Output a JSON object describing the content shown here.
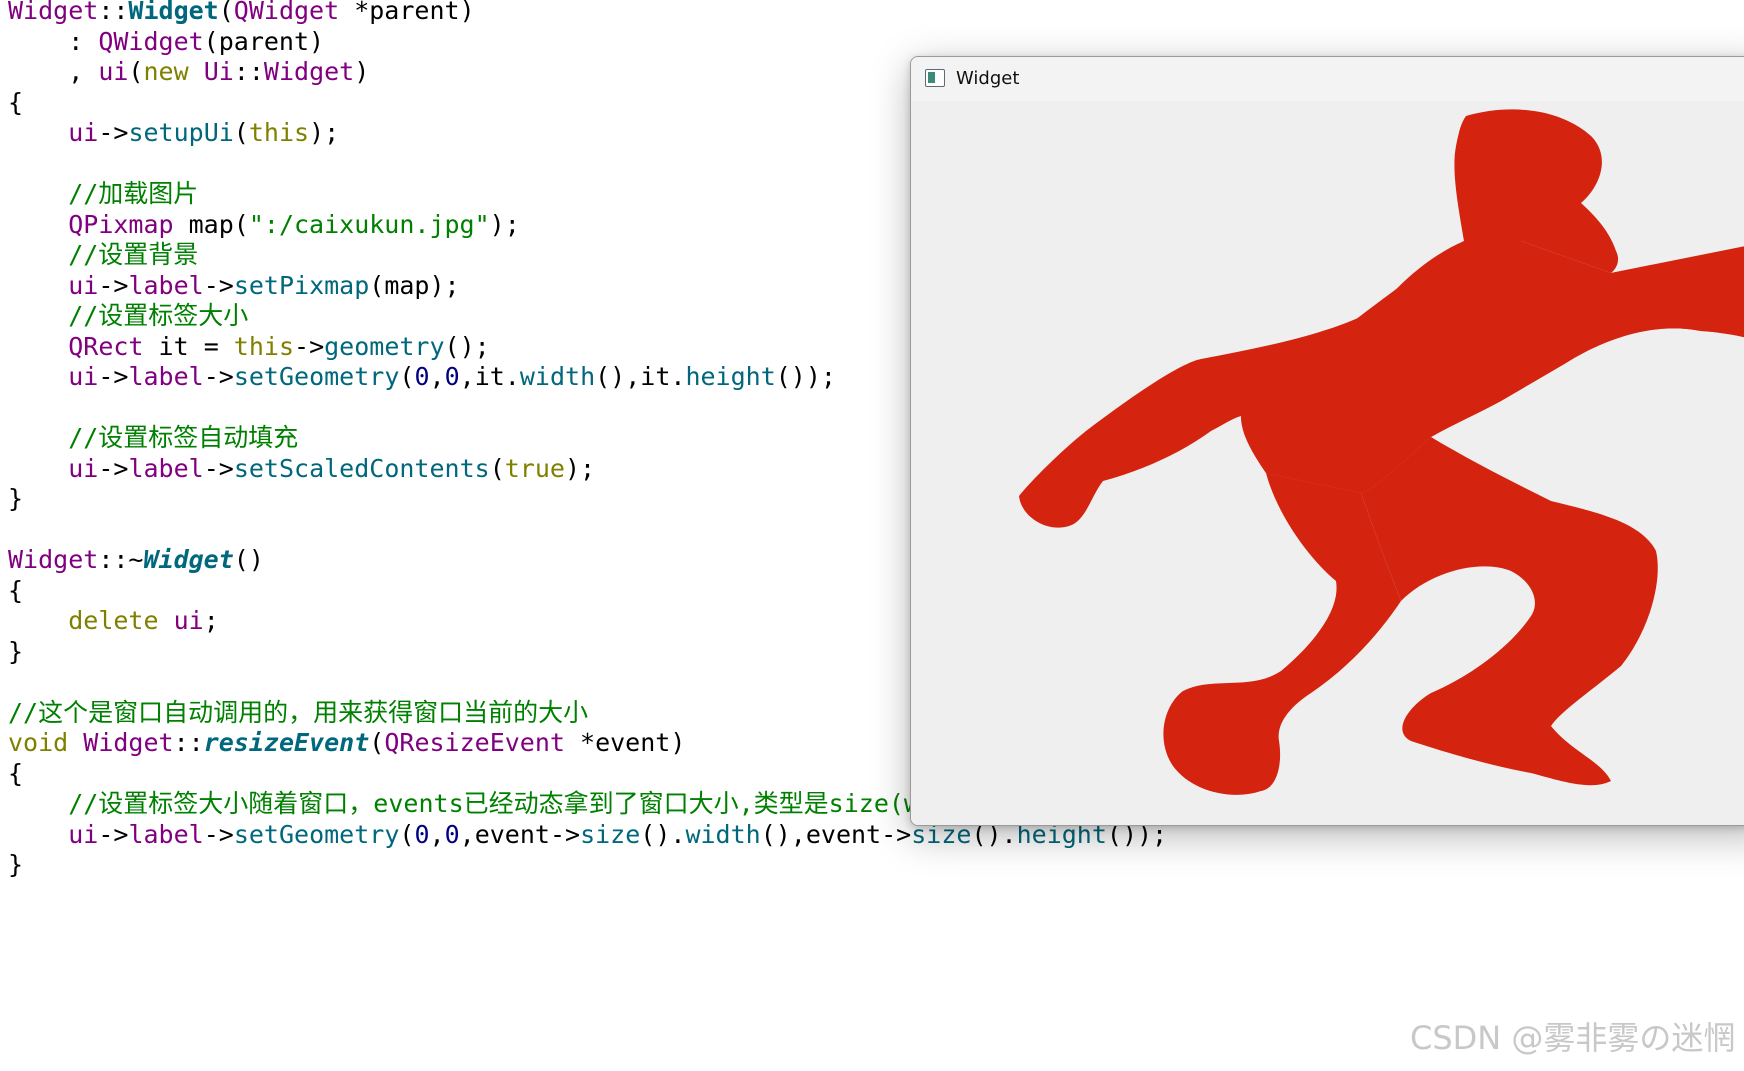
{
  "code_editor": {
    "lines": [
      [
        {
          "t": "Widget",
          "c": "type"
        },
        {
          "t": "::",
          "c": "plain"
        },
        {
          "t": "Widget",
          "c": "fn-bold"
        },
        {
          "t": "(",
          "c": "plain"
        },
        {
          "t": "QWidget",
          "c": "type"
        },
        {
          "t": " *parent)",
          "c": "plain"
        }
      ],
      [
        {
          "t": "    : ",
          "c": "plain"
        },
        {
          "t": "QWidget",
          "c": "type"
        },
        {
          "t": "(parent)",
          "c": "plain"
        }
      ],
      [
        {
          "t": "    , ",
          "c": "plain"
        },
        {
          "t": "ui",
          "c": "type"
        },
        {
          "t": "(",
          "c": "plain"
        },
        {
          "t": "new",
          "c": "kw"
        },
        {
          "t": " ",
          "c": "plain"
        },
        {
          "t": "Ui",
          "c": "type"
        },
        {
          "t": "::",
          "c": "plain"
        },
        {
          "t": "Widget",
          "c": "type"
        },
        {
          "t": ")",
          "c": "plain"
        }
      ],
      [
        {
          "t": "{",
          "c": "plain"
        }
      ],
      [
        {
          "t": "    ",
          "c": "plain"
        },
        {
          "t": "ui",
          "c": "type"
        },
        {
          "t": "->",
          "c": "plain"
        },
        {
          "t": "setupUi",
          "c": "fn"
        },
        {
          "t": "(",
          "c": "plain"
        },
        {
          "t": "this",
          "c": "kw"
        },
        {
          "t": ");",
          "c": "plain"
        }
      ],
      [],
      [
        {
          "t": "    //加载图片",
          "c": "cmt"
        }
      ],
      [
        {
          "t": "    ",
          "c": "plain"
        },
        {
          "t": "QPixmap",
          "c": "type"
        },
        {
          "t": " map(",
          "c": "plain"
        },
        {
          "t": "\":/caixukun.jpg\"",
          "c": "str"
        },
        {
          "t": ");",
          "c": "plain"
        }
      ],
      [
        {
          "t": "    //设置背景",
          "c": "cmt"
        }
      ],
      [
        {
          "t": "    ",
          "c": "plain"
        },
        {
          "t": "ui",
          "c": "type"
        },
        {
          "t": "->",
          "c": "plain"
        },
        {
          "t": "label",
          "c": "type"
        },
        {
          "t": "->",
          "c": "plain"
        },
        {
          "t": "setPixmap",
          "c": "fn"
        },
        {
          "t": "(map);",
          "c": "plain"
        }
      ],
      [
        {
          "t": "    //设置标签大小",
          "c": "cmt"
        }
      ],
      [
        {
          "t": "    ",
          "c": "plain"
        },
        {
          "t": "QRect",
          "c": "type"
        },
        {
          "t": " it = ",
          "c": "plain"
        },
        {
          "t": "this",
          "c": "kw"
        },
        {
          "t": "->",
          "c": "plain"
        },
        {
          "t": "geometry",
          "c": "fn"
        },
        {
          "t": "();",
          "c": "plain"
        }
      ],
      [
        {
          "t": "    ",
          "c": "plain"
        },
        {
          "t": "ui",
          "c": "type"
        },
        {
          "t": "->",
          "c": "plain"
        },
        {
          "t": "label",
          "c": "type"
        },
        {
          "t": "->",
          "c": "plain"
        },
        {
          "t": "setGeometry",
          "c": "fn"
        },
        {
          "t": "(",
          "c": "plain"
        },
        {
          "t": "0",
          "c": "num"
        },
        {
          "t": ",",
          "c": "plain"
        },
        {
          "t": "0",
          "c": "num"
        },
        {
          "t": ",it.",
          "c": "plain"
        },
        {
          "t": "width",
          "c": "fn"
        },
        {
          "t": "(),it.",
          "c": "plain"
        },
        {
          "t": "height",
          "c": "fn"
        },
        {
          "t": "());",
          "c": "plain"
        }
      ],
      [],
      [
        {
          "t": "    //设置标签自动填充",
          "c": "cmt"
        }
      ],
      [
        {
          "t": "    ",
          "c": "plain"
        },
        {
          "t": "ui",
          "c": "type"
        },
        {
          "t": "->",
          "c": "plain"
        },
        {
          "t": "label",
          "c": "type"
        },
        {
          "t": "->",
          "c": "plain"
        },
        {
          "t": "setScaledContents",
          "c": "fn"
        },
        {
          "t": "(",
          "c": "plain"
        },
        {
          "t": "true",
          "c": "kw"
        },
        {
          "t": ");",
          "c": "plain"
        }
      ],
      [
        {
          "t": "}",
          "c": "plain"
        }
      ],
      [],
      [
        {
          "t": "Widget",
          "c": "type"
        },
        {
          "t": "::~",
          "c": "plain"
        },
        {
          "t": "Widget",
          "c": "fn-bold-italic"
        },
        {
          "t": "()",
          "c": "plain"
        }
      ],
      [
        {
          "t": "{",
          "c": "plain"
        }
      ],
      [
        {
          "t": "    ",
          "c": "plain"
        },
        {
          "t": "delete",
          "c": "kw"
        },
        {
          "t": " ",
          "c": "plain"
        },
        {
          "t": "ui",
          "c": "type"
        },
        {
          "t": ";",
          "c": "plain"
        }
      ],
      [
        {
          "t": "}",
          "c": "plain"
        }
      ],
      [],
      [
        {
          "t": "//这个是窗口自动调用的，用来获得窗口当前的大小",
          "c": "cmt"
        }
      ],
      [
        {
          "t": "void",
          "c": "kw"
        },
        {
          "t": " ",
          "c": "plain"
        },
        {
          "t": "Widget",
          "c": "type"
        },
        {
          "t": "::",
          "c": "plain"
        },
        {
          "t": "resizeEvent",
          "c": "fn-bold-italic"
        },
        {
          "t": "(",
          "c": "plain"
        },
        {
          "t": "QResizeEvent",
          "c": "type"
        },
        {
          "t": " *event)",
          "c": "plain"
        }
      ],
      [
        {
          "t": "{",
          "c": "plain"
        }
      ],
      [
        {
          "t": "    //设置标签大小随着窗口，events已经动态拿到了窗口大小,类型是size(width,height)",
          "c": "cmt"
        }
      ],
      [
        {
          "t": "    ",
          "c": "plain"
        },
        {
          "t": "ui",
          "c": "type"
        },
        {
          "t": "->",
          "c": "plain"
        },
        {
          "t": "label",
          "c": "type"
        },
        {
          "t": "->",
          "c": "plain"
        },
        {
          "t": "setGeometry",
          "c": "fn"
        },
        {
          "t": "(",
          "c": "plain"
        },
        {
          "t": "0",
          "c": "num"
        },
        {
          "t": ",",
          "c": "plain"
        },
        {
          "t": "0",
          "c": "num"
        },
        {
          "t": ",event->",
          "c": "plain"
        },
        {
          "t": "size",
          "c": "fn"
        },
        {
          "t": "().",
          "c": "plain"
        },
        {
          "t": "width",
          "c": "fn"
        },
        {
          "t": "(),event->",
          "c": "plain"
        },
        {
          "t": "size",
          "c": "fn"
        },
        {
          "t": "().",
          "c": "plain"
        },
        {
          "t": "height",
          "c": "fn"
        },
        {
          "t": "());",
          "c": "plain"
        }
      ],
      [
        {
          "t": "}",
          "c": "plain"
        }
      ]
    ],
    "colors": {
      "type": "#800080",
      "keyword": "#808000",
      "function": "#00677c",
      "string": "#008000",
      "comment": "#008000",
      "number": "#000080"
    }
  },
  "app_window": {
    "title": "Widget",
    "icon": "window-icon",
    "label_pixmap": {
      "content": "red-silhouette-figure",
      "fill_color": "#d42410",
      "background_color": "#efefef"
    }
  },
  "watermark": {
    "text": "CSDN @雾非雾の迷惘"
  }
}
